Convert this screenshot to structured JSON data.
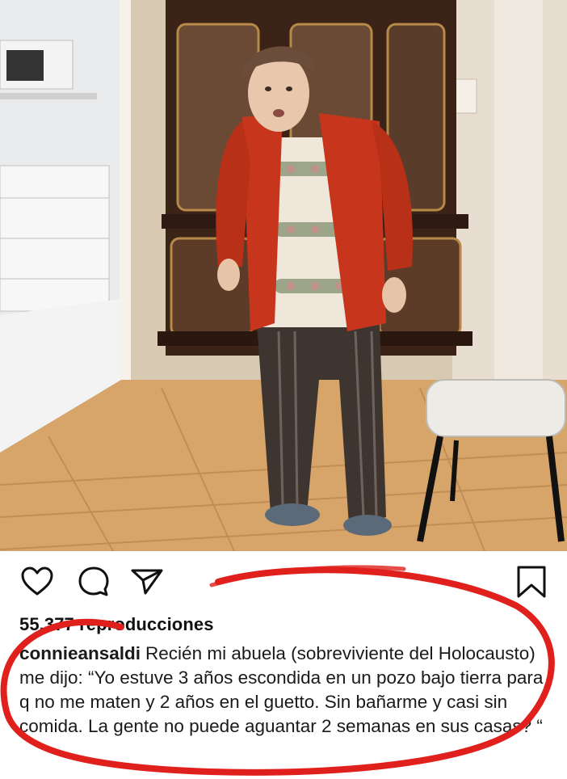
{
  "post": {
    "views_text": "55.377 reproducciones",
    "username": "connieansaldi",
    "caption": "Recién mi abuela (sobreviviente del Holocausto) me dijo: “Yo estuve 3 años escondida en un pozo bajo tierra para q no me maten y 2 años en el guetto. Sin bañarme y casi sin comida. La gente no puede aguantar 2 semanas en sus casas? “"
  },
  "icons": {
    "like": "heart-icon",
    "comment": "comment-icon",
    "share": "paper-plane-icon",
    "save": "bookmark-icon"
  },
  "colors": {
    "annotation": "#e0201c",
    "cardigan": "#c7361c",
    "floor": "#d7a56a"
  }
}
